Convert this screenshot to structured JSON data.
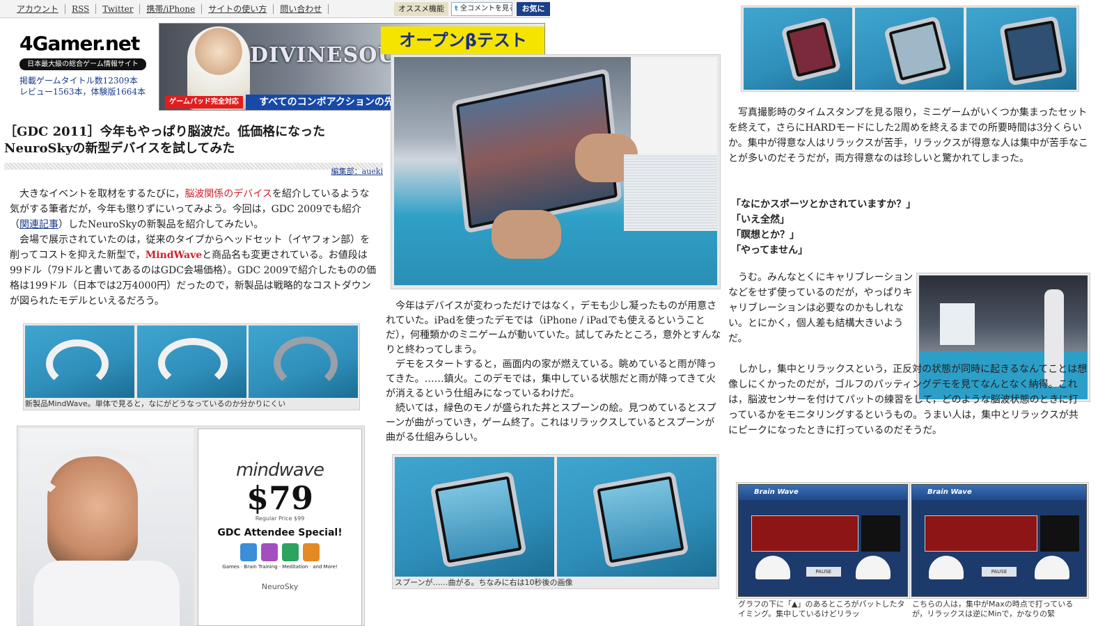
{
  "nav": {
    "links": [
      "アカウント",
      "RSS",
      "Twitter",
      "携帯/iPhone",
      "サイトの使い方",
      "問い合わせ"
    ],
    "osusume": "オススメ機能",
    "comment_button": "全コメントを見る",
    "comment_icon": "t",
    "favorite": "お気に"
  },
  "header": {
    "logo": "4Gamer.net",
    "tagline": "日本最大級の総合ゲーム情報サイト",
    "stats_line1": "掲載ゲームタイトル数12309本",
    "stats_line2": "レビュー1563本，体験版1664本"
  },
  "banner": {
    "game": "DIVINESOUL",
    "beta": "オープンβテスト",
    "pad": "ゲームパッド完全対応",
    "combo": "すべてのコンボアクションの先"
  },
  "article": {
    "title": "［GDC 2011］今年もやっぱり脳波だ。低価格になったNeuroSkyの新型デバイスを試してみた",
    "author": "編集部：aueki",
    "p1_a": "大きなイベントを取材をするたびに，",
    "p1_link": "脳波関係のデバイス",
    "p1_b": "を紹介しているような気がする筆者だが，今年も懲りずにいってみよう。今回は，GDC 2009でも紹介（",
    "p1_rel": "関連記事",
    "p1_c": "）したNeuroSkyの新製品を紹介してみたい。",
    "p2_a": "会場で展示されていたのは，従来のタイプからヘッドセット（イヤフォン部）を削ってコストを抑えた新型で，",
    "p2_name": "MindWave",
    "p2_b": "と商品名も変更されている。お値段は99ドル（79ドルと書いてあるのはGDC会場価格）。GDC 2009で紹介したものの価格は199ドル（日本では2万4000円）だったので，新製品は戦略的なコストダウンが図られたモデルといえるだろう。",
    "caption1": "新製品MindWave。単体で見ると，なにがどうなっているのか分かりにくい",
    "poster": {
      "brand": "mindwave",
      "price": "$79",
      "regular": "Regular Price $99",
      "special1": "GDC Attendee Special!",
      "games": "Games · Brain Training · Meditation · and More!",
      "maker": "NeuroSky"
    },
    "mid_p1": "今年はデバイスが変わっただけではなく，デモも少し凝ったものが用意されていた。iPadを使ったデモでは（iPhone / iPadでも使えるということだ），何種類かのミニゲームが動いていた。試してみたところ，意外とすんなりと終わってしまう。",
    "mid_p2": "デモをスタートすると，画面内の家が燃えている。眺めていると雨が降ってきた。……鎮火。このデモでは，集中している状態だと雨が降ってきて火が消えるという仕組みになっているわけだ。",
    "mid_p3": "続いては，緑色のモノが盛られた丼とスプーンの絵。見つめているとスプーンが曲がっていき，ゲーム終了。これはリラックスしているとスプーンが曲がる仕組みらしい。",
    "caption2": "スプーンが……曲がる。ちなみに右は10秒後の画像",
    "right_p1": "写真撮影時のタイムスタンプを見る限り，ミニゲームがいくつか集まったセットを終えて，さらにHARDモードにした2周めを終えるまでの所要時間は3分くらいか。集中が得意な人はリラックスが苦手，リラックスが得意な人は集中が苦手なことが多いのだそうだが，両方得意なのは珍しいと驚かれてしまった。",
    "quotes": [
      "「なにかスポーツとかされていますか？」",
      "「いえ全然」",
      "「瞑想とか？」",
      "「やってません」"
    ],
    "right_p2": "うむ。みんなとくにキャリブレーションなどをせず使っているのだが，やっぱりキャリブレーションは必要なのかもしれない。とにかく，個人差も結構大きいようだ。",
    "right_p3_a": "しかし，集中とリラックスという，正反対の状態が同時に起きるなんてことは想像しにくかったのだが，ゴルフのパッティングデモを見てなんとなく納得。",
    "right_p3_b": "これは，脳波センサーを付けてパットの練習をして，どのような脳波状態のときに打っているかをモニタリングするというもの。うまい人は，集中とリラックスが共にピークになったときに打っているのだそうだ。",
    "brainwave_title": "Brain Wave",
    "pause_label": "PAUSE",
    "caption3": "グラフの下に「▲」のあるところがパットしたタイミング。集中しているけどリラッ",
    "caption4": "こちらの人は，集中がMaxの時点で打っているが，リラックスは逆にMinで，かなりの緊"
  }
}
